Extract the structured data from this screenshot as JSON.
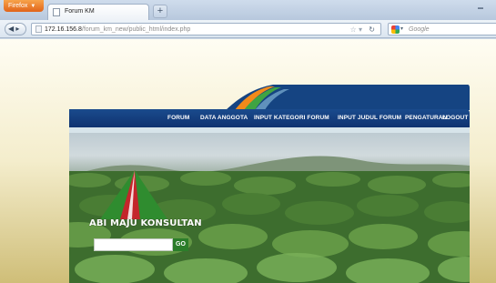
{
  "browser": {
    "app_button": "Firefox",
    "tab_title": "Forum KM",
    "new_tab": "+",
    "url_host": "172.16.156.8",
    "url_path": "/forum_km_new/public_html/index.php",
    "search_placeholder": "Google",
    "icons": [
      "back-forward-icon",
      "site-identity-icon",
      "bookmark-star-icon",
      "reload-icon",
      "google-icon"
    ]
  },
  "site": {
    "menu": [
      "FORUM",
      "DATA ANGGOTA",
      "INPUT KATEGORI FORUM",
      "INPUT JUDUL FORUM",
      "PENGATURAN",
      "LOGOUT"
    ],
    "brand": "ABI MAJU KONSULTAN",
    "search_value": "",
    "go_label": "GO",
    "colors": {
      "menubar": "#1a4b8d",
      "accent_green": "#2c7d2a",
      "accent_red": "#c4262b",
      "swoosh_orange": "#f28a1a",
      "swoosh_green": "#3fa443"
    }
  }
}
